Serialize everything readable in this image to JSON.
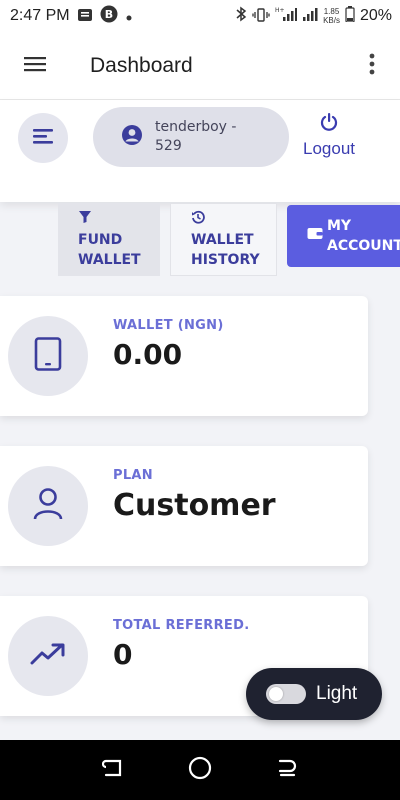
{
  "status_bar": {
    "time": "2:47 PM",
    "network_speed_value": "1.85",
    "network_speed_unit": "KB/s",
    "battery": "20%"
  },
  "app_bar": {
    "title": "Dashboard",
    "menu_icon": "hamburger-icon",
    "more_icon": "more-vert-icon"
  },
  "header": {
    "user_label": "tenderboy - 529",
    "logout_label": "Logout"
  },
  "tabs": [
    {
      "label": "FUND WALLET",
      "icon": "filter-icon"
    },
    {
      "label": "WALLET HISTORY",
      "icon": "history-icon"
    },
    {
      "label": "MY ACCOUNT",
      "icon": "wallet-icon",
      "active": true
    }
  ],
  "cards": [
    {
      "caption": "WALLET (NGN)",
      "value": "0.00",
      "icon": "tablet-icon"
    },
    {
      "caption": "PLAN",
      "value": "Customer",
      "icon": "user-icon"
    },
    {
      "caption": "TOTAL REFERRED.",
      "value": "0",
      "icon": "trending-up-icon"
    }
  ],
  "theme_toggle": {
    "label": "Light",
    "enabled": false
  },
  "colors": {
    "accent": "#5b5de0",
    "accent_text": "#3b3d9c",
    "caption": "#6b6fd6",
    "toggle_bg": "#1f2230"
  }
}
